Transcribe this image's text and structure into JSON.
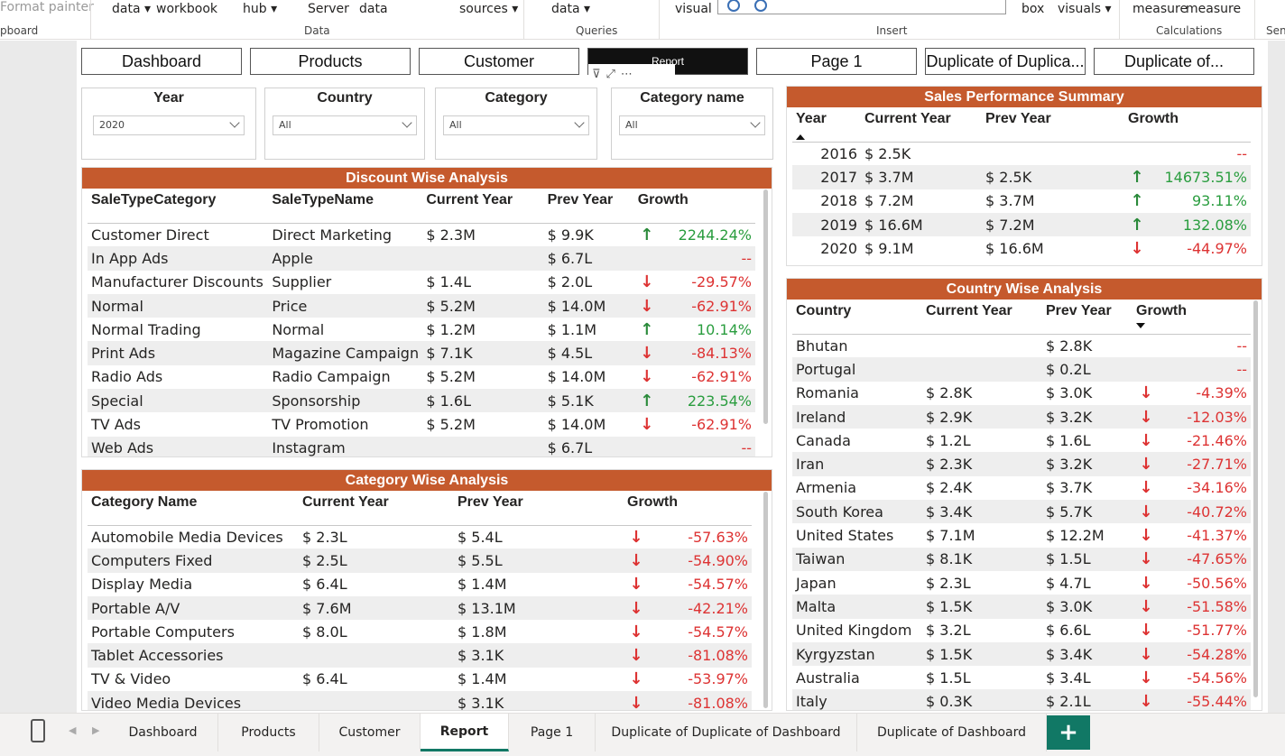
{
  "ribbon": {
    "items": [
      "Format painter",
      "data",
      "workbook",
      "hub",
      "Server",
      "data",
      "sources",
      "data",
      "visual",
      "box",
      "visuals",
      "measure",
      "measure"
    ],
    "groups": [
      "pboard",
      "Data",
      "Queries",
      "Insert",
      "Calculations",
      "Sen"
    ]
  },
  "nav_buttons": [
    {
      "label": "Dashboard"
    },
    {
      "label": "Products"
    },
    {
      "label": "Customer"
    },
    {
      "label": "Report"
    },
    {
      "label": "Page 1"
    },
    {
      "label": "Duplicate of Duplica..."
    },
    {
      "label": "Duplicate of..."
    }
  ],
  "slicers": [
    {
      "title": "Year",
      "value": "2020"
    },
    {
      "title": "Country",
      "value": "All"
    },
    {
      "title": "Category",
      "value": "All"
    },
    {
      "title": "Category name",
      "value": "All"
    }
  ],
  "discount": {
    "title": "Discount Wise Analysis",
    "headers": [
      "SaleTypeCategory",
      "SaleTypeName",
      "Current Year",
      "Prev Year",
      "Growth"
    ],
    "rows": [
      [
        "Customer Direct",
        "Direct Marketing",
        "$ 2.3M",
        "$ 9.9K",
        "up",
        "2244.24%"
      ],
      [
        "In App Ads",
        "Apple",
        "",
        "$ 6.7L",
        "",
        "--"
      ],
      [
        "Manufacturer Discounts",
        "Supplier",
        "$ 1.4L",
        "$ 2.0L",
        "down",
        "-29.57%"
      ],
      [
        "Normal",
        "Price",
        "$ 5.2M",
        "$ 14.0M",
        "down",
        "-62.91%"
      ],
      [
        "Normal Trading",
        "Normal",
        "$ 1.2M",
        "$ 1.1M",
        "up",
        "10.14%"
      ],
      [
        "Print Ads",
        "Magazine Campaign",
        "$ 7.1K",
        "$ 4.5L",
        "down",
        "-84.13%"
      ],
      [
        "Radio Ads",
        "Radio Campaign",
        "$ 5.2M",
        "$ 14.0M",
        "down",
        "-62.91%"
      ],
      [
        "Special",
        "Sponsorship",
        "$ 1.6L",
        "$ 5.1K",
        "up",
        "223.54%"
      ],
      [
        "TV Ads",
        "TV Promotion",
        "$ 5.2M",
        "$ 14.0M",
        "down",
        "-62.91%"
      ],
      [
        "Web Ads",
        "Instagram",
        "",
        "$ 6.7L",
        "",
        "--"
      ]
    ]
  },
  "category": {
    "title": "Category Wise Analysis",
    "headers": [
      "Category Name",
      "Current Year",
      "Prev Year",
      "Growth"
    ],
    "rows": [
      [
        "Automobile Media Devices",
        "$ 2.3L",
        "$ 5.4L",
        "down",
        "-57.63%"
      ],
      [
        "Computers Fixed",
        "$ 2.5L",
        "$ 5.5L",
        "down",
        "-54.90%"
      ],
      [
        "Display Media",
        "$ 6.4L",
        "$ 1.4M",
        "down",
        "-54.57%"
      ],
      [
        "Portable A/V",
        "$ 7.6M",
        "$ 13.1M",
        "down",
        "-42.21%"
      ],
      [
        "Portable Computers",
        "$ 8.0L",
        "$ 1.8M",
        "down",
        "-54.57%"
      ],
      [
        "Tablet Accessories",
        "",
        "$ 3.1K",
        "down",
        "-81.08%"
      ],
      [
        "TV & Video",
        "$ 6.4L",
        "$ 1.4M",
        "down",
        "-53.97%"
      ],
      [
        "Video Media Devices",
        "",
        "$ 3.1K",
        "down",
        "-81.08%"
      ]
    ]
  },
  "sales": {
    "title": "Sales Performance Summary",
    "headers": [
      "Year",
      "Current Year",
      "Prev Year",
      "Growth"
    ],
    "rows": [
      [
        "2016",
        "$ 2.5K",
        "",
        "",
        "--"
      ],
      [
        "2017",
        "$ 3.7M",
        "$ 2.5K",
        "up",
        "14673.51%"
      ],
      [
        "2018",
        "$ 7.2M",
        "$ 3.7M",
        "up",
        "93.11%"
      ],
      [
        "2019",
        "$ 16.6M",
        "$ 7.2M",
        "up",
        "132.08%"
      ],
      [
        "2020",
        "$ 9.1M",
        "$ 16.6M",
        "down",
        "-44.97%"
      ]
    ]
  },
  "country": {
    "title": "Country Wise Analysis",
    "headers": [
      "Country",
      "Current Year",
      "Prev Year",
      "Growth"
    ],
    "rows": [
      [
        "Bhutan",
        "",
        "$ 2.8K",
        "",
        "--"
      ],
      [
        "Portugal",
        "",
        "$ 0.2L",
        "",
        "--"
      ],
      [
        "Romania",
        "$ 2.8K",
        "$ 3.0K",
        "down",
        "-4.39%"
      ],
      [
        "Ireland",
        "$ 2.9K",
        "$ 3.2K",
        "down",
        "-12.03%"
      ],
      [
        "Canada",
        "$ 1.2L",
        "$ 1.6L",
        "down",
        "-21.46%"
      ],
      [
        "Iran",
        "$ 2.3K",
        "$ 3.2K",
        "down",
        "-27.71%"
      ],
      [
        "Armenia",
        "$ 2.4K",
        "$ 3.7K",
        "down",
        "-34.16%"
      ],
      [
        "South Korea",
        "$ 3.4K",
        "$ 5.7K",
        "down",
        "-40.72%"
      ],
      [
        "United States",
        "$ 7.1M",
        "$ 12.2M",
        "down",
        "-41.37%"
      ],
      [
        "Taiwan",
        "$ 8.1K",
        "$ 1.5L",
        "down",
        "-47.65%"
      ],
      [
        "Japan",
        "$ 2.3L",
        "$ 4.7L",
        "down",
        "-50.56%"
      ],
      [
        "Malta",
        "$ 1.5K",
        "$ 3.0K",
        "down",
        "-51.58%"
      ],
      [
        "United Kingdom",
        "$ 3.2L",
        "$ 6.6L",
        "down",
        "-51.77%"
      ],
      [
        "Kyrgyzstan",
        "$ 1.5K",
        "$ 3.4K",
        "down",
        "-54.28%"
      ],
      [
        "Australia",
        "$ 1.5L",
        "$ 3.4L",
        "down",
        "-54.56%"
      ],
      [
        "Italy",
        "$ 0.3K",
        "$ 2.1L",
        "down",
        "-55.44%"
      ]
    ]
  },
  "tabs": [
    {
      "label": "Dashboard"
    },
    {
      "label": "Products"
    },
    {
      "label": "Customer"
    },
    {
      "label": "Report",
      "active": true
    },
    {
      "label": "Page 1"
    },
    {
      "label": "Duplicate of Duplicate of Dashboard"
    },
    {
      "label": "Duplicate of Dashboard"
    }
  ],
  "add_tab_label": "+",
  "colors": {
    "title_bar": "#c55a2d",
    "up": "#2a8a3a",
    "down": "#d33",
    "tab_accent": "#117865"
  }
}
